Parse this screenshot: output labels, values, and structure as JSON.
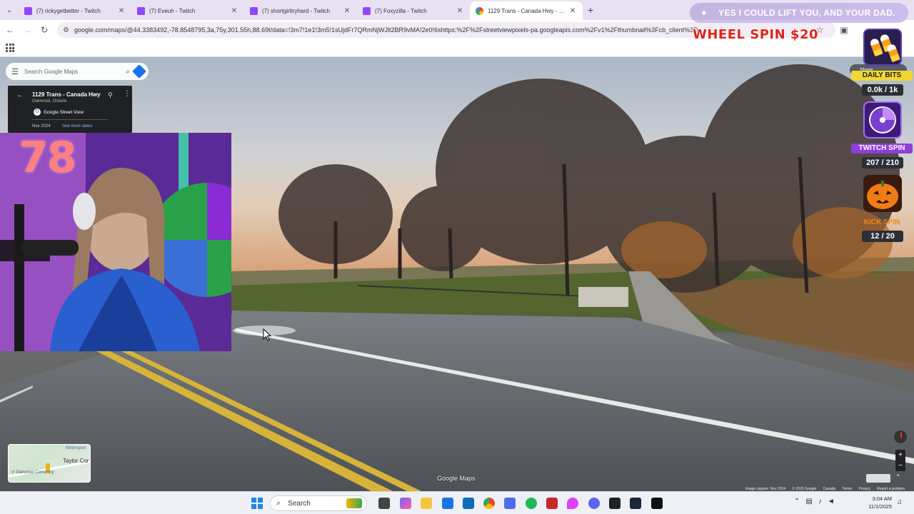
{
  "browser": {
    "tabs": [
      {
        "title": "(7) rickygetbetter - Twitch",
        "favicon": "twitch-icon",
        "active": false
      },
      {
        "title": "(7) Eveuh - Twitch",
        "favicon": "twitch-icon",
        "active": false
      },
      {
        "title": "(7) shortgirltryhard - Twitch",
        "favicon": "twitch-icon",
        "active": false
      },
      {
        "title": "(7) Foxyzilla - Twitch",
        "favicon": "twitch-icon",
        "active": false
      },
      {
        "title": "1129 Trans - Canada Hwy - Goo",
        "favicon": "google-maps-icon",
        "active": true
      }
    ],
    "url": "google.com/maps/@44.3383492,-78.8548795,3a,75y,301.55h,88.69t/data=!3m7!1e1!3m5!1sUjdFr7QRmNjWJlt2BR9vMA!2e0!6shttps:%2F%2Fstreetviewpixels-pa.googleapis.com%2Fv1%2Fthumbnail%3Fcb_client%3D"
  },
  "maps": {
    "search_placeholder": "Search Google Maps",
    "place": {
      "name": "1129 Trans - Canada Hwy",
      "city": "Oakwood, Ontario",
      "source": "Google Street View",
      "date": "Nov 2024",
      "more_dates": "See more dates"
    },
    "minimap": {
      "label_top": "Motorsport",
      "label_mid": "Taylor Cor",
      "label_bottom": "st Oakwood Cemetery"
    },
    "brand": "Google Maps",
    "share": "Share",
    "footer": [
      "Image capture: Nov 2024",
      "© 2025 Google",
      "Canada",
      "Terms",
      "Privacy",
      "Report a problem"
    ]
  },
  "stream": {
    "counter": "78",
    "banner": "YES I COULD LIFT YOU, AND YOUR DAD.",
    "wheel_spin": "WHEEL SPIN $20",
    "daily_bits_label": "DAILY BITS",
    "daily_bits_count": "0.0k / 1k",
    "twitch_spin_label": "TWITCH SPIN",
    "twitch_spin_count": "207 / 210",
    "kick_spin_label": "KICK SPIN",
    "kick_spin_count": "12 / 20",
    "colors": {
      "daily_bits": "#f2d633",
      "twitch_spin": "#8e3fd6",
      "kick_spin": "#f08a1c",
      "counter": "#ff8080"
    }
  },
  "taskbar": {
    "search_label": "Search",
    "time": "3:04 AM",
    "date": "11/1/2025"
  }
}
